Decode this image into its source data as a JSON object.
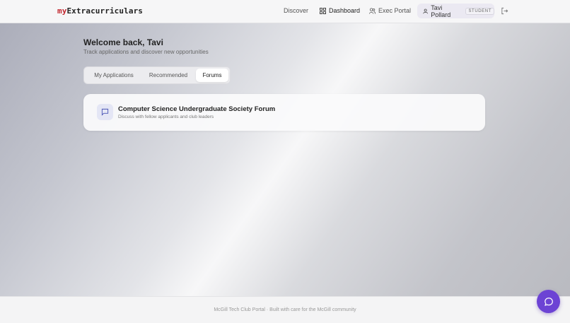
{
  "navbar": {
    "logo_prefix": "my",
    "logo_suffix": "Extracurriculars",
    "links": {
      "discover": "Discover",
      "dashboard": "Dashboard",
      "exec_portal": "Exec Portal"
    },
    "user": {
      "name": "Tavi Pollard",
      "role": "STUDENT"
    },
    "logout_icon": "logout-icon"
  },
  "welcome": {
    "title": "Welcome back, Tavi",
    "subtitle": "Track applications and discover new opportunities"
  },
  "tabs": {
    "my_applications": "My Applications",
    "recommended": "Recommended",
    "forums": "Forums",
    "active": "Forums"
  },
  "forums": [
    {
      "title": "Computer Science Undergraduate Society Forum",
      "subtitle": "Discuss with fellow applicants and club leaders",
      "icon": "message-square-icon"
    }
  ],
  "footer": {
    "text": "McGill Tech Club Portal · Built with care for the McGill community"
  },
  "colors": {
    "accent": "#6c43d4",
    "logo_red": "#c2262e",
    "chip_bg": "#ebe9f2"
  }
}
